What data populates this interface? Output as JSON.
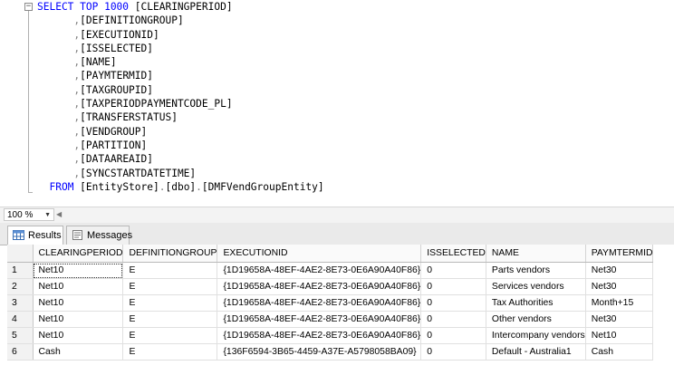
{
  "editor": {
    "fold_glyph": "−",
    "lines": [
      {
        "indent": "",
        "kw": "SELECT TOP 1000 ",
        "text": "[CLEARINGPERIOD]"
      },
      {
        "indent": "      ",
        "comma": ",",
        "text": "[DEFINITIONGROUP]"
      },
      {
        "indent": "      ",
        "comma": ",",
        "text": "[EXECUTIONID]"
      },
      {
        "indent": "      ",
        "comma": ",",
        "text": "[ISSELECTED]"
      },
      {
        "indent": "      ",
        "comma": ",",
        "text": "[NAME]"
      },
      {
        "indent": "      ",
        "comma": ",",
        "text": "[PAYMTERMID]"
      },
      {
        "indent": "      ",
        "comma": ",",
        "text": "[TAXGROUPID]"
      },
      {
        "indent": "      ",
        "comma": ",",
        "text": "[TAXPERIODPAYMENTCODE_PL]"
      },
      {
        "indent": "      ",
        "comma": ",",
        "text": "[TRANSFERSTATUS]"
      },
      {
        "indent": "      ",
        "comma": ",",
        "text": "[VENDGROUP]"
      },
      {
        "indent": "      ",
        "comma": ",",
        "text": "[PARTITION]"
      },
      {
        "indent": "      ",
        "comma": ",",
        "text": "[DATAAREAID]"
      },
      {
        "indent": "      ",
        "comma": ",",
        "text": "[SYNCSTARTDATETIME]"
      },
      {
        "indent": "  ",
        "kw": "FROM ",
        "from_parts": [
          "[EntityStore]",
          ".",
          "[dbo]",
          ".",
          "[DMFVendGroupEntity]"
        ]
      }
    ]
  },
  "zoom": {
    "value": "100 %",
    "dropdown_glyph": "▼",
    "scroll_glyph": "◀"
  },
  "tabs": {
    "results": "Results",
    "messages": "Messages"
  },
  "grid": {
    "columns": [
      "CLEARINGPERIOD",
      "DEFINITIONGROUP",
      "EXECUTIONID",
      "ISSELECTED",
      "NAME",
      "PAYMTERMID"
    ],
    "rows": [
      {
        "n": "1",
        "cells": [
          "Net10",
          "E",
          "{1D19658A-48EF-4AE2-8E73-0E6A90A40F86}",
          "0",
          "Parts vendors",
          "Net30"
        ]
      },
      {
        "n": "2",
        "cells": [
          "Net10",
          "E",
          "{1D19658A-48EF-4AE2-8E73-0E6A90A40F86}",
          "0",
          "Services vendors",
          "Net30"
        ]
      },
      {
        "n": "3",
        "cells": [
          "Net10",
          "E",
          "{1D19658A-48EF-4AE2-8E73-0E6A90A40F86}",
          "0",
          "Tax Authorities",
          "Month+15"
        ]
      },
      {
        "n": "4",
        "cells": [
          "Net10",
          "E",
          "{1D19658A-48EF-4AE2-8E73-0E6A90A40F86}",
          "0",
          "Other vendors",
          "Net30"
        ]
      },
      {
        "n": "5",
        "cells": [
          "Net10",
          "E",
          "{1D19658A-48EF-4AE2-8E73-0E6A90A40F86}",
          "0",
          "Intercompany vendors",
          "Net10"
        ]
      },
      {
        "n": "6",
        "cells": [
          "Cash",
          "E",
          "{136F6594-3B65-4459-A37E-A5798058BA09}",
          "0",
          "Default - Australia1",
          "Cash"
        ]
      }
    ]
  }
}
